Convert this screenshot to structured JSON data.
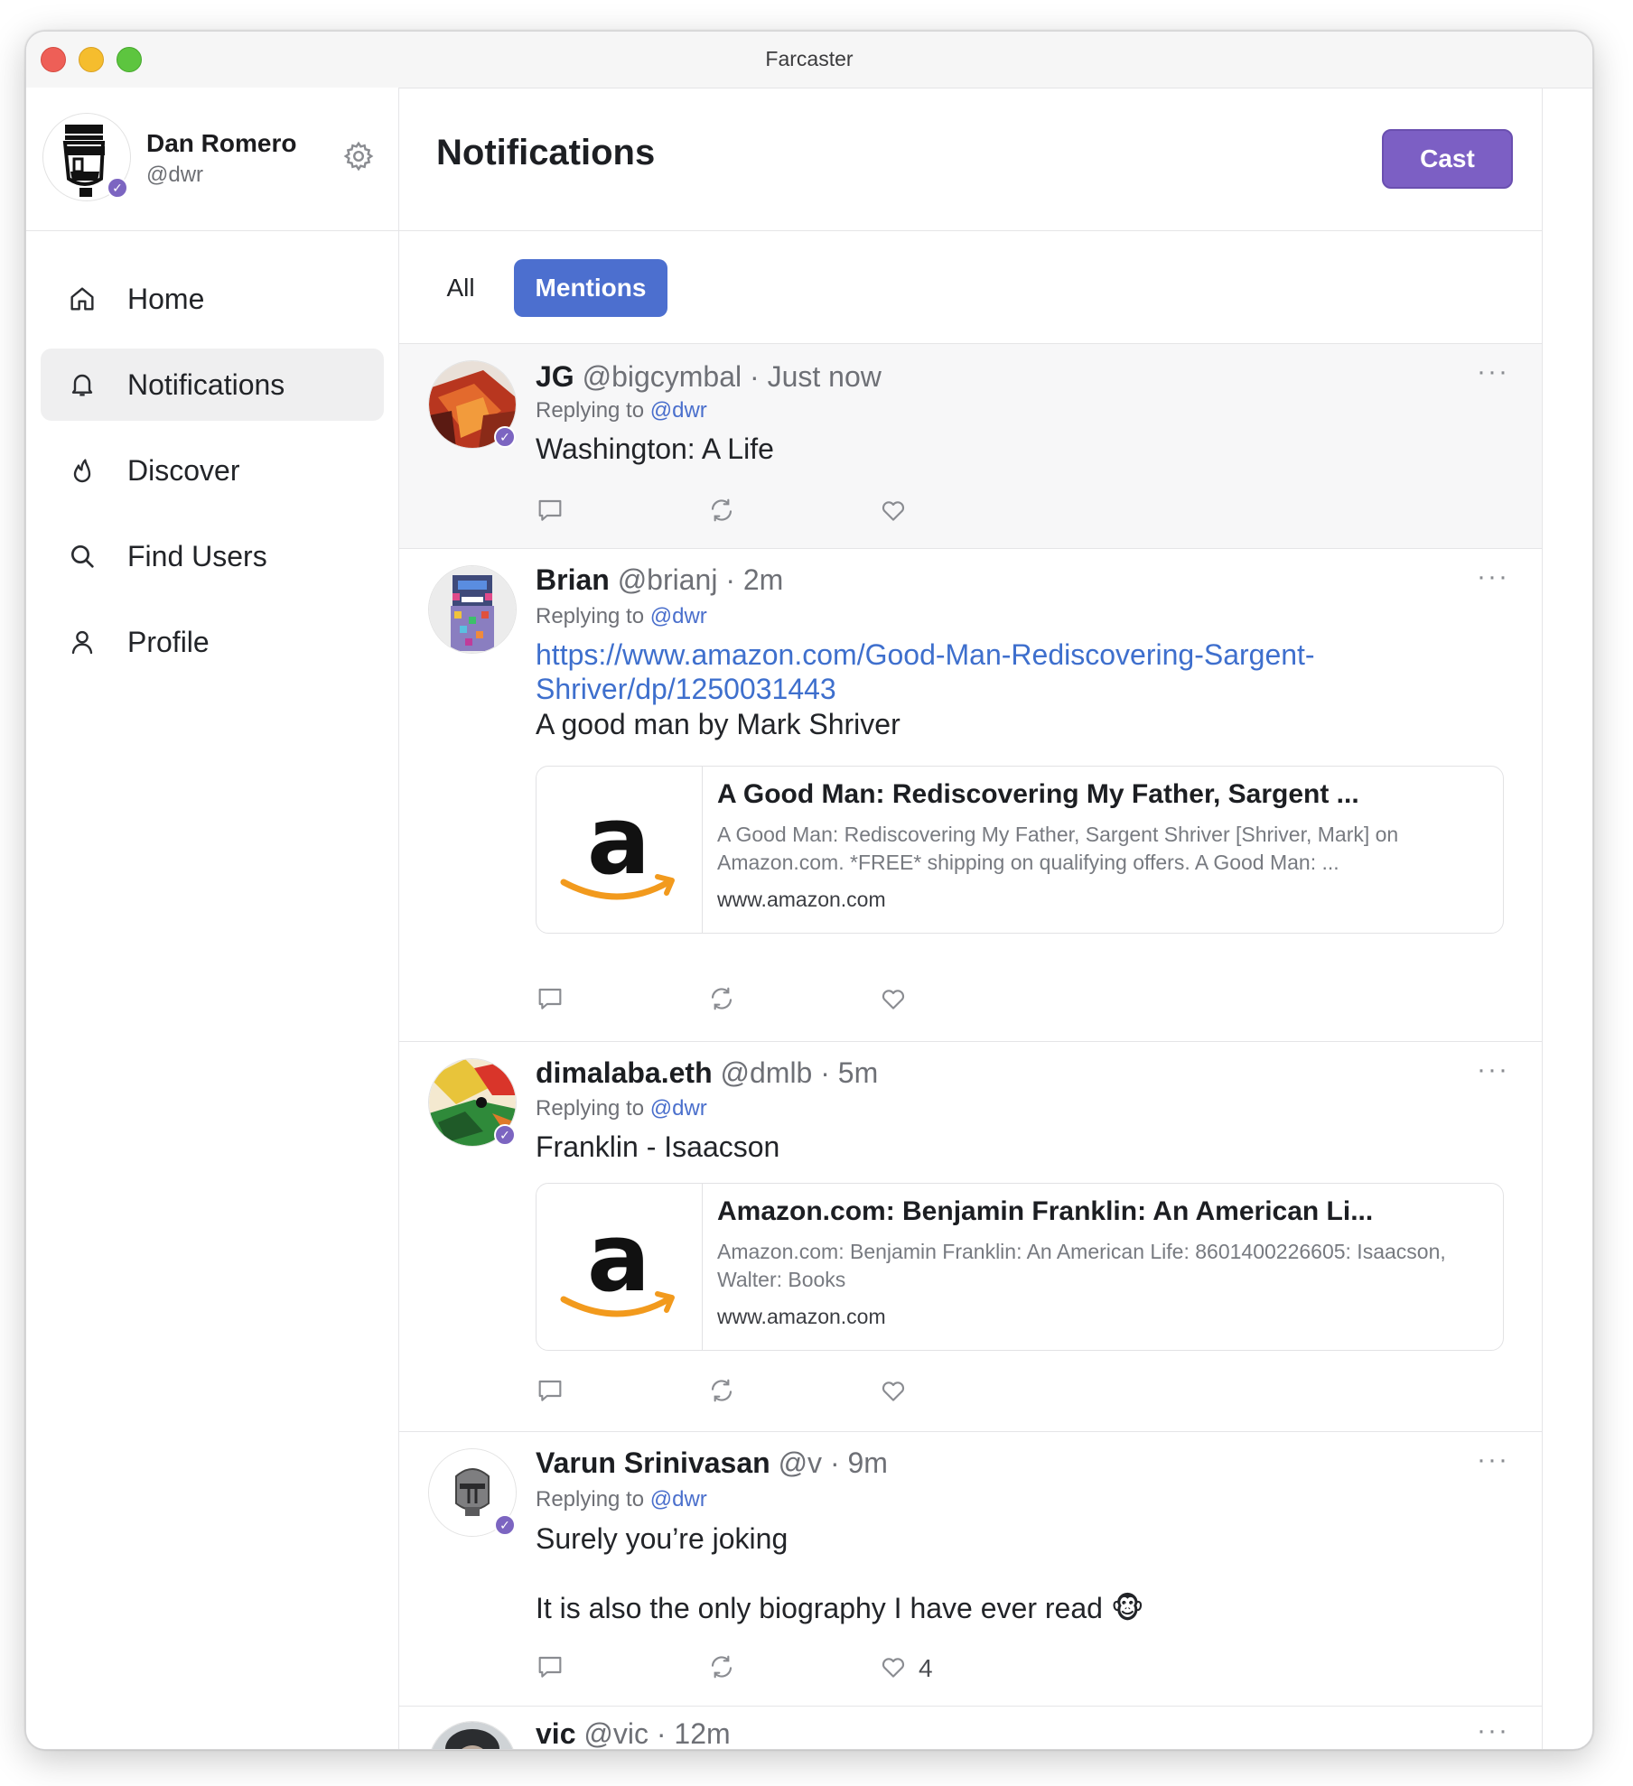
{
  "window": {
    "title": "Farcaster"
  },
  "user": {
    "name": "Dan Romero",
    "handle": "@dwr"
  },
  "nav": [
    {
      "label": "Home",
      "icon": "home-icon",
      "active": false
    },
    {
      "label": "Notifications",
      "icon": "bell-icon",
      "active": true
    },
    {
      "label": "Discover",
      "icon": "flame-icon",
      "active": false
    },
    {
      "label": "Find Users",
      "icon": "search-icon",
      "active": false
    },
    {
      "label": "Profile",
      "icon": "user-icon",
      "active": false
    }
  ],
  "header": {
    "title": "Notifications",
    "cast_label": "Cast"
  },
  "tabs": {
    "all": "All",
    "mentions": "Mentions",
    "selected": "Mentions"
  },
  "colors": {
    "accent": "#7c5fc4",
    "tab_active": "#4c6fcf",
    "link": "#3e6fcd",
    "verified": "#7c65c1"
  },
  "casts": [
    {
      "name": "JG",
      "handle": "@bigcymbal",
      "time": "Just now",
      "reply_prefix": "Replying to",
      "reply_to": "@dwr",
      "text": "Washington: A Life",
      "likes": ""
    },
    {
      "name": "Brian",
      "handle": "@brianj",
      "time": "2m",
      "reply_prefix": "Replying to",
      "reply_to": "@dwr",
      "link": "https://www.amazon.com/Good-Man-Rediscovering-Sargent-Shriver/dp/1250031443",
      "text": "A good man by Mark Shriver",
      "embed": {
        "title": "A Good Man: Rediscovering My Father, Sargent ...",
        "description": "A Good Man: Rediscovering My Father, Sargent Shriver [Shriver, Mark] on Amazon.com. *FREE* shipping on qualifying offers. A Good Man: ...",
        "domain": "www.amazon.com"
      },
      "likes": ""
    },
    {
      "name": "dimalaba.eth",
      "handle": "@dmlb",
      "time": "5m",
      "reply_prefix": "Replying to",
      "reply_to": "@dwr",
      "text": "Franklin - Isaacson",
      "embed": {
        "title": "Amazon.com: Benjamin Franklin: An American Li...",
        "description": "Amazon.com: Benjamin Franklin: An American Life: 8601400226605: Isaacson, Walter: Books",
        "domain": "www.amazon.com"
      },
      "likes": ""
    },
    {
      "name": "Varun Srinivasan",
      "handle": "@v",
      "time": "9m",
      "reply_prefix": "Replying to",
      "reply_to": "@dwr",
      "text": "Surely you’re joking",
      "text2": "It is also the only biography I have ever read 🐵",
      "likes": "4"
    },
    {
      "name": "vic",
      "handle": "@vic",
      "time": "12m"
    }
  ],
  "dot": "·",
  "more": "···"
}
